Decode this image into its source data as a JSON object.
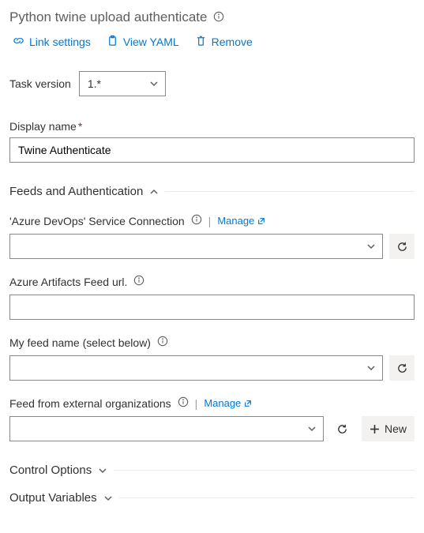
{
  "title": "Python twine upload authenticate",
  "commands": {
    "link": "Link settings",
    "yaml": "View YAML",
    "remove": "Remove"
  },
  "taskVersion": {
    "label": "Task version",
    "value": "1.*"
  },
  "displayName": {
    "label": "Display name",
    "value": "Twine Authenticate"
  },
  "sections": {
    "feeds": "Feeds and Authentication",
    "control": "Control Options",
    "output": "Output Variables"
  },
  "fields": {
    "serviceConn": {
      "label": "'Azure DevOps' Service Connection",
      "manage": "Manage",
      "value": ""
    },
    "feedUrl": {
      "label": "Azure Artifacts Feed url.",
      "value": ""
    },
    "feedName": {
      "label": "My feed name (select below)",
      "value": ""
    },
    "external": {
      "label": "Feed from external organizations",
      "manage": "Manage",
      "value": "",
      "newLabel": "New"
    }
  }
}
